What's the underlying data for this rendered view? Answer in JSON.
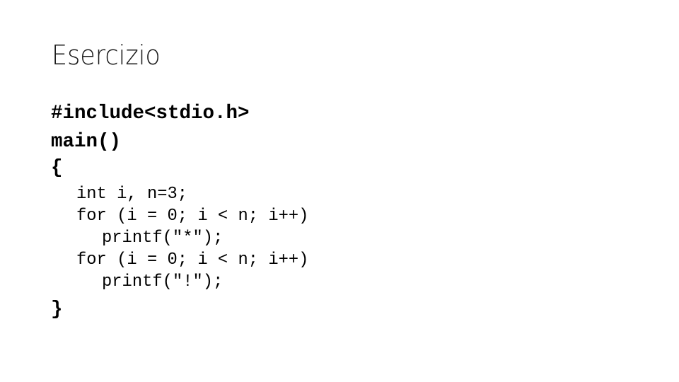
{
  "slide": {
    "title": "Esercizio",
    "code_lines": [
      "#include<stdio.h>",
      "main()",
      "{",
      "int i, n=3;",
      "for (i = 0; i < n; i++)",
      "printf(\"*\");",
      "for (i = 0; i < n; i++)",
      "printf(\"!\");",
      "}"
    ]
  }
}
